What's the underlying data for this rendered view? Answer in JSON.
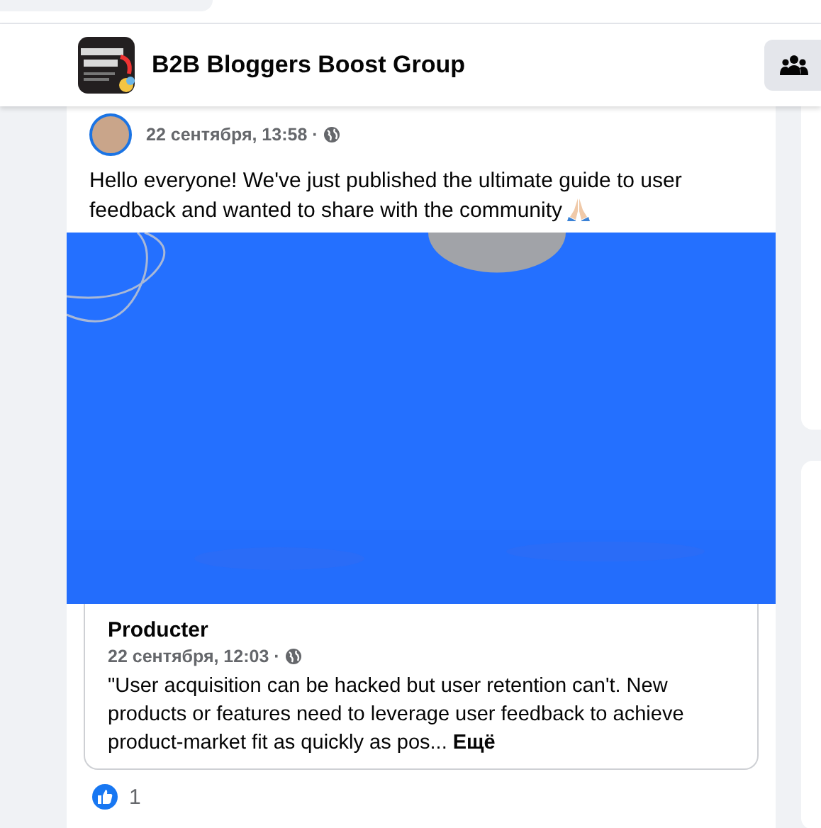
{
  "group": {
    "name": "B2B Bloggers Boost Group"
  },
  "post": {
    "timestamp": "22 сентября, 13:58 ·",
    "text": "Hello everyone! We've just published the ultimate guide to user feedback and wanted to share with the community",
    "link_preview": {
      "title": "Producter",
      "timestamp": "22 сентября, 12:03 ·",
      "excerpt": "\"User acquisition can be hacked but user retention can't. New products or features need to leverage user feedback to achieve product-market fit as quickly as pos...",
      "more": "Ещё"
    },
    "reactions": {
      "count": "1"
    }
  }
}
